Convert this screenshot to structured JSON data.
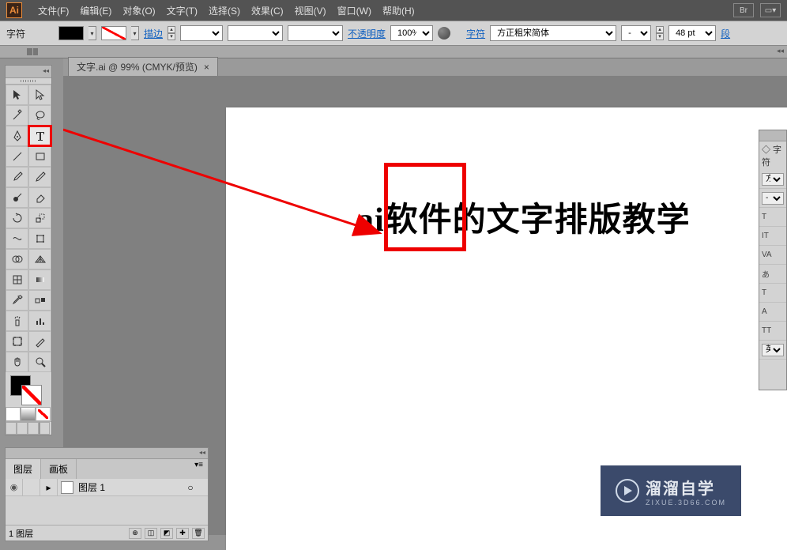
{
  "app": {
    "logo": "Ai"
  },
  "menu": {
    "items": [
      "文件(F)",
      "编辑(E)",
      "对象(O)",
      "文字(T)",
      "选择(S)",
      "效果(C)",
      "视图(V)",
      "窗口(W)",
      "帮助(H)"
    ]
  },
  "controlbar": {
    "mode_label": "字符",
    "stroke_label": "描边",
    "stroke_value": "",
    "opacity_label": "不透明度",
    "opacity_value": "100%",
    "char_link": "字符",
    "font_label": "方正粗宋简体",
    "font_style": "-",
    "font_size": "48 pt",
    "para_link": "段"
  },
  "document": {
    "tab_label": "文字.ai @ 99% (CMYK/预览)",
    "canvas_text": "ai软件的文字排版教学"
  },
  "layers": {
    "tabs": [
      "图层",
      "画板"
    ],
    "row": {
      "name": "图层 1"
    },
    "footer_count": "1 图层"
  },
  "char_panel": {
    "title": "◇ 字符",
    "font": "方正",
    "style": "-",
    "rows": [
      "T",
      "IT",
      "VA",
      "あ",
      "T",
      "A",
      "TT",
      "英语"
    ]
  },
  "watermark": {
    "title": "溜溜自学",
    "url": "ZIXUE.3D66.COM"
  }
}
